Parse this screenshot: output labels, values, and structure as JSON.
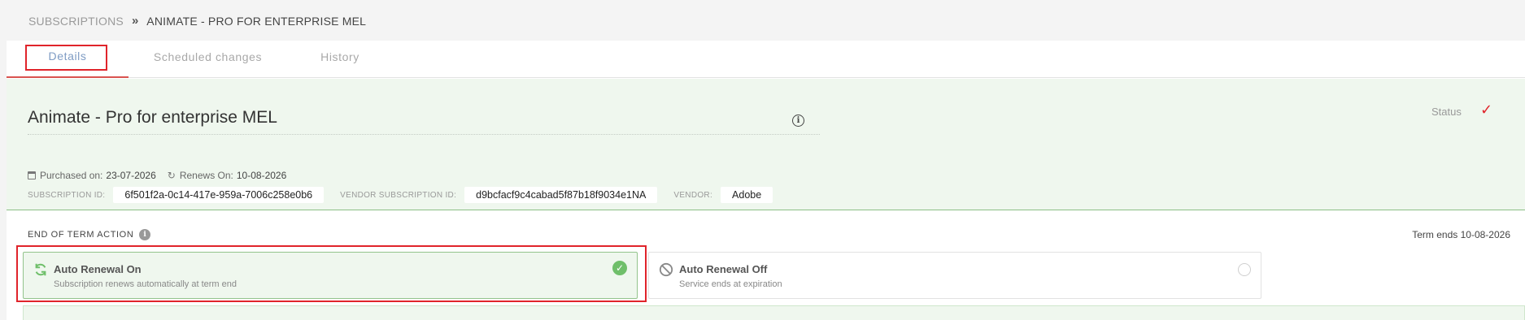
{
  "breadcrumb": {
    "parent": "SUBSCRIPTIONS",
    "separator": "»",
    "current": "ANIMATE - PRO FOR ENTERPRISE MEL"
  },
  "tabs": [
    {
      "label": "Details",
      "active": true
    },
    {
      "label": "Scheduled changes",
      "active": false
    },
    {
      "label": "History",
      "active": false
    }
  ],
  "subscription": {
    "title": "Animate - Pro for enterprise MEL",
    "status_label": "Status",
    "status_icon": "check-icon",
    "purchased_label": "Purchased on:",
    "purchased_value": "23-07-2026",
    "renews_label": "Renews On:",
    "renews_value": "10-08-2026",
    "subscription_id_label": "SUBSCRIPTION ID:",
    "subscription_id": "6f501f2a-0c14-417e-959a-7006c258e0b6",
    "vendor_subscription_id_label": "VENDOR SUBSCRIPTION ID:",
    "vendor_subscription_id": "d9bcfacf9c4cabad5f87b18f9034e1NA",
    "vendor_label": "VENDOR:",
    "vendor": "Adobe"
  },
  "end_of_term": {
    "label": "END OF TERM ACTION",
    "term_ends": "Term ends 10-08-2026",
    "options": [
      {
        "title": "Auto Renewal On",
        "subtitle": "Subscription renews automatically at term end",
        "selected": true
      },
      {
        "title": "Auto Renewal Off",
        "subtitle": "Service ends at expiration",
        "selected": false
      }
    ]
  },
  "colors": {
    "accent_red": "#e0242b",
    "success_green": "#6fbf6a",
    "panel_green": "#eff7ee",
    "tab_active_blue": "#7f9cc4"
  }
}
